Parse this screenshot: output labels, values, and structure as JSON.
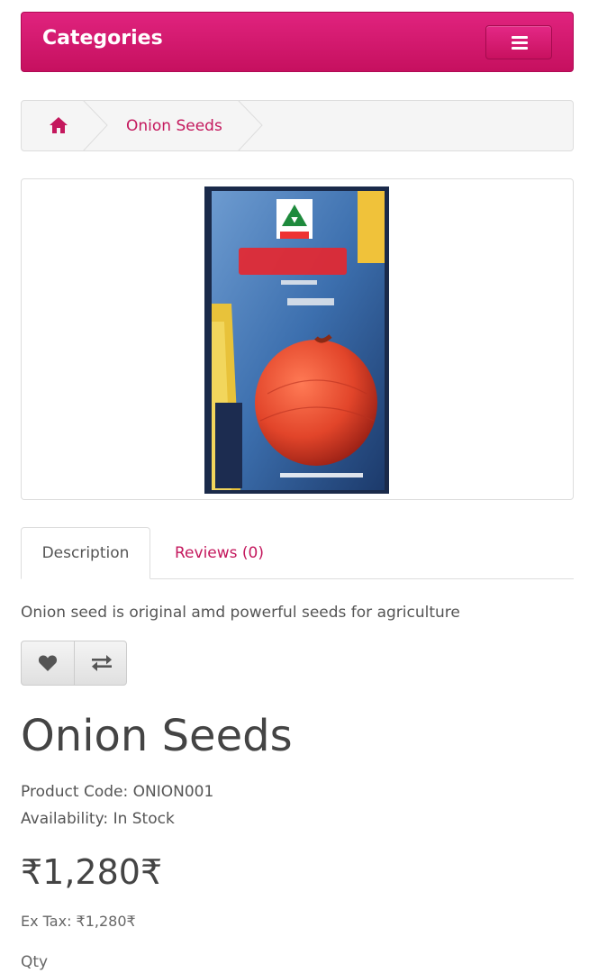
{
  "header": {
    "categories_label": "Categories"
  },
  "breadcrumb": {
    "item": "Onion Seeds"
  },
  "product_image": {
    "alt": "Onion Seeds"
  },
  "tabs": [
    {
      "label": "Description"
    },
    {
      "label": "Reviews (0)"
    }
  ],
  "description": "Onion seed is original amd powerful seeds for agriculture",
  "product": {
    "title": "Onion Seeds",
    "code_label": "Product Code:",
    "code": "ONION001",
    "availability_label": "Availability:",
    "availability": "In Stock",
    "price": "₹1,280₹",
    "ex_tax_label": "Ex Tax:",
    "ex_tax": "₹1,280₹",
    "qty_label": "Qty"
  },
  "colors": {
    "brand": "#d31871",
    "link": "#c4185d"
  },
  "icons": {
    "menu": "hamburger-icon",
    "home": "home-icon",
    "wishlist": "heart-icon",
    "compare": "exchange-icon"
  }
}
